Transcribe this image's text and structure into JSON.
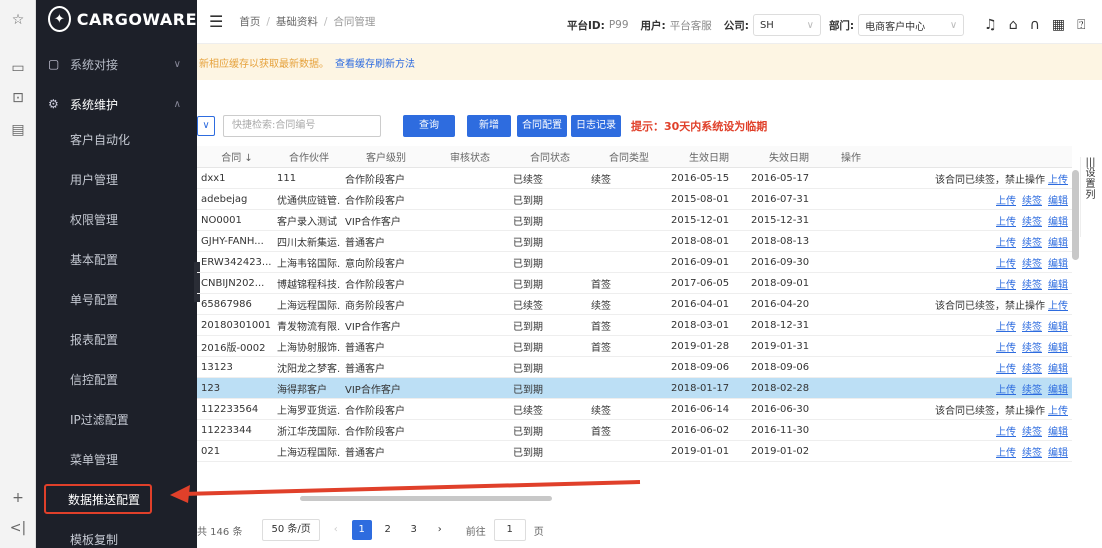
{
  "browser_strip": {
    "icons": [
      "star-icon",
      "book-icon",
      "screenshot-icon",
      "document-icon"
    ],
    "bottom_icons": [
      "plus-icon",
      "collapse-icon"
    ]
  },
  "sidebar": {
    "logo_text": "CARGOWARE",
    "groups": [
      {
        "label": "系统对接",
        "icon": "link-icon"
      },
      {
        "label": "系统维护",
        "icon": "gear-icon"
      }
    ],
    "items": [
      {
        "label": "客户自动化"
      },
      {
        "label": "用户管理"
      },
      {
        "label": "权限管理"
      },
      {
        "label": "基本配置"
      },
      {
        "label": "单号配置"
      },
      {
        "label": "报表配置"
      },
      {
        "label": "信控配置"
      },
      {
        "label": "IP过滤配置"
      },
      {
        "label": "菜单管理"
      },
      {
        "label": "数据推送配置",
        "highlighted": true
      },
      {
        "label": "模板复制"
      }
    ]
  },
  "header": {
    "breadcrumb": [
      "首页",
      "基础资料",
      "合同管理"
    ],
    "platform_label": "平台ID:",
    "platform_value": "P99",
    "user_label": "用户:",
    "user_value": "平台客服",
    "company_label": "公司:",
    "company_value": "SH",
    "dept_label": "部门:",
    "dept_value": "电商客户中心"
  },
  "notice": {
    "text": "新相应缓存以获取最新数据。",
    "link": "查看缓存刷新方法"
  },
  "toolbar": {
    "search_placeholder": "快捷检索:合同编号",
    "query_label": "查询",
    "add_label": "新增",
    "contract_config_label": "合同配置",
    "log_label": "日志记录",
    "tip": "提示：30天内系统设为临期"
  },
  "table": {
    "columns": [
      "合同 ↓",
      "合作伙伴",
      "客户级别",
      "审核状态",
      "合同状态",
      "合同类型",
      "生效日期",
      "失效日期",
      "操作"
    ],
    "rows": [
      {
        "code": "dxx1",
        "partner": "111",
        "level": "合作阶段客户",
        "audit": "",
        "status": "已续签",
        "type": "续签",
        "start": "2016-05-15",
        "end": "2016-05-17",
        "op": "renewed"
      },
      {
        "code": "adebejag",
        "partner": "优通供应链管...",
        "level": "合作阶段客户",
        "audit": "",
        "status": "已到期",
        "type": "",
        "start": "2015-08-01",
        "end": "2016-07-31",
        "op": "links"
      },
      {
        "code": "NO0001",
        "partner": "客户录入测试",
        "level": "VIP合作客户",
        "audit": "",
        "status": "已到期",
        "type": "",
        "start": "2015-12-01",
        "end": "2015-12-31",
        "op": "links"
      },
      {
        "code": "GJHY-FANH...",
        "partner": "四川太新集运...",
        "level": "普通客户",
        "audit": "",
        "status": "已到期",
        "type": "",
        "start": "2018-08-01",
        "end": "2018-08-13",
        "op": "links"
      },
      {
        "code": "ERW342423...",
        "partner": "上海韦铭国际...",
        "level": "意向阶段客户",
        "audit": "",
        "status": "已到期",
        "type": "",
        "start": "2016-09-01",
        "end": "2016-09-30",
        "op": "links"
      },
      {
        "code": "CNBIJN202...",
        "partner": "博越锦程科技...",
        "level": "合作阶段客户",
        "audit": "",
        "status": "已到期",
        "type": "首签",
        "start": "2017-06-05",
        "end": "2018-09-01",
        "op": "links"
      },
      {
        "code": "65867986",
        "partner": "上海远程国际...",
        "level": "商务阶段客户",
        "audit": "",
        "status": "已续签",
        "type": "续签",
        "start": "2016-04-01",
        "end": "2016-04-20",
        "op": "renewed"
      },
      {
        "code": "20180301001",
        "partner": "青发物流有限...",
        "level": "VIP合作客户",
        "audit": "",
        "status": "已到期",
        "type": "首签",
        "start": "2018-03-01",
        "end": "2018-12-31",
        "op": "links"
      },
      {
        "code": "2016版-0002",
        "partner": "上海协射服饰...",
        "level": "普通客户",
        "audit": "",
        "status": "已到期",
        "type": "首签",
        "start": "2019-01-28",
        "end": "2019-01-31",
        "op": "links"
      },
      {
        "code": "13123",
        "partner": "沈阳龙之梦客...",
        "level": "普通客户",
        "audit": "",
        "status": "已到期",
        "type": "",
        "start": "2018-09-06",
        "end": "2018-09-06",
        "op": "links"
      },
      {
        "code": "123",
        "partner": "海得邦客户",
        "level": "VIP合作客户",
        "audit": "",
        "status": "已到期",
        "type": "",
        "start": "2018-01-17",
        "end": "2018-02-28",
        "op": "links",
        "selected": true
      },
      {
        "code": "112233564",
        "partner": "上海罗亚货运...",
        "level": "合作阶段客户",
        "audit": "",
        "status": "已续签",
        "type": "续签",
        "start": "2016-06-14",
        "end": "2016-06-30",
        "op": "renewed"
      },
      {
        "code": "11223344",
        "partner": "浙江华茂国际...",
        "level": "合作阶段客户",
        "audit": "",
        "status": "已到期",
        "type": "首签",
        "start": "2016-06-02",
        "end": "2016-11-30",
        "op": "links"
      },
      {
        "code": "021",
        "partner": "上海迈程国际...",
        "level": "普通客户",
        "audit": "",
        "status": "已到期",
        "type": "",
        "start": "2019-01-01",
        "end": "2019-01-02",
        "op": "links"
      }
    ],
    "op_renewed_text": "该合同已续签，禁止操作",
    "op_upload": "上传",
    "op_renew": "续签",
    "op_edit": "编辑",
    "set_columns_label": "设置列"
  },
  "pager": {
    "total": "共 146 条",
    "page_size": "50 条/页",
    "pages": [
      "1",
      "2",
      "3"
    ],
    "current_page": "1",
    "goto_label": "前往",
    "goto_value": "1",
    "page_suffix": "页"
  },
  "colors": {
    "sidebar_bg": "#1d2029",
    "primary": "#2e6cdf",
    "tip_red": "#e0402a",
    "notice_bg": "#fdf5e3",
    "selected_row": "#bcdff5"
  }
}
